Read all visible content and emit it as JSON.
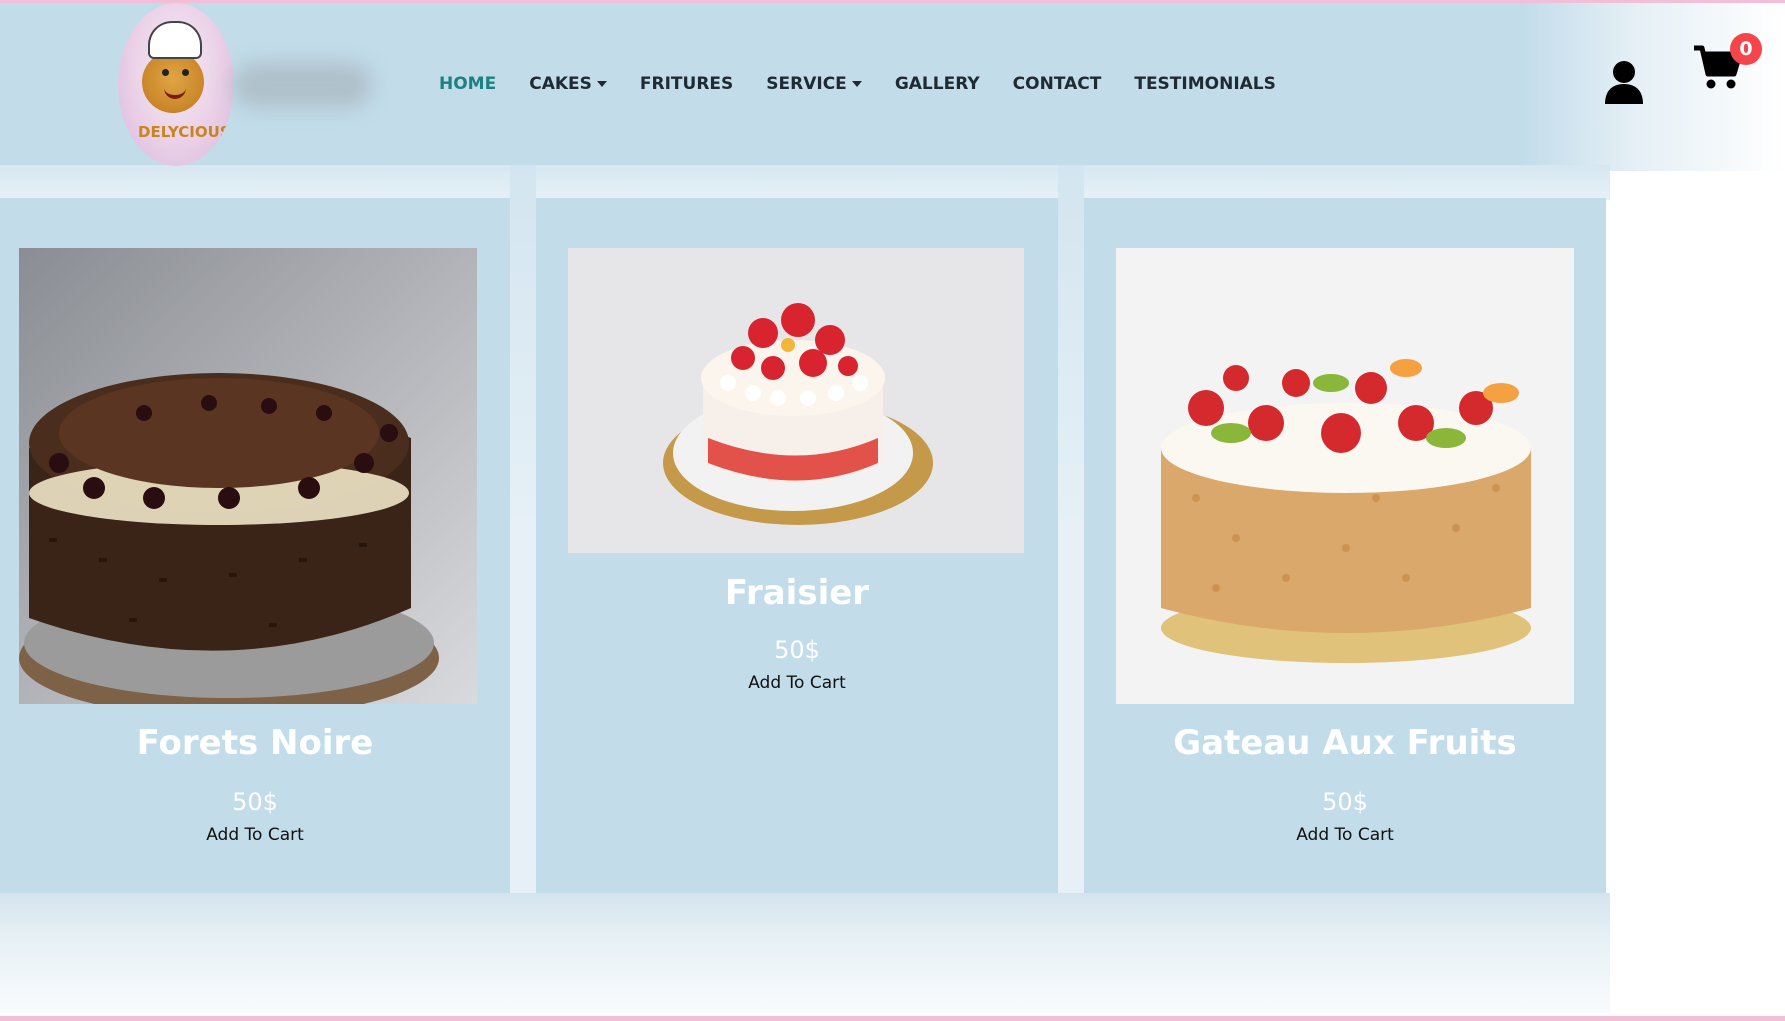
{
  "brand": {
    "logo_text": "DELYCIOUS"
  },
  "nav": {
    "items": [
      {
        "label": "HOME",
        "active": true,
        "dropdown": false
      },
      {
        "label": "CAKES",
        "active": false,
        "dropdown": true
      },
      {
        "label": "FRITURES",
        "active": false,
        "dropdown": false
      },
      {
        "label": "SERVICE",
        "active": false,
        "dropdown": true
      },
      {
        "label": "GALLERY",
        "active": false,
        "dropdown": false
      },
      {
        "label": "CONTACT",
        "active": false,
        "dropdown": false
      },
      {
        "label": "TESTIMONIALS",
        "active": false,
        "dropdown": false
      }
    ]
  },
  "header_icons": {
    "user_icon": "user-icon",
    "cart_icon": "cart-icon",
    "cart_count": "0"
  },
  "products": [
    {
      "name": "Forets Noire",
      "price": "50$",
      "add_label": "Add To Cart",
      "image": "black-forest-cake"
    },
    {
      "name": "Fraisier",
      "price": "50$",
      "add_label": "Add To Cart",
      "image": "strawberry-cake"
    },
    {
      "name": "Gateau Aux Fruits",
      "price": "50$",
      "add_label": "Add To Cart",
      "image": "fruit-cake"
    }
  ],
  "colors": {
    "header_bg": "#c2dcea",
    "active_nav": "#1d8082",
    "nav_text": "#1f2a33",
    "badge": "#f5454a",
    "accent_line": "#f1bfd8"
  }
}
